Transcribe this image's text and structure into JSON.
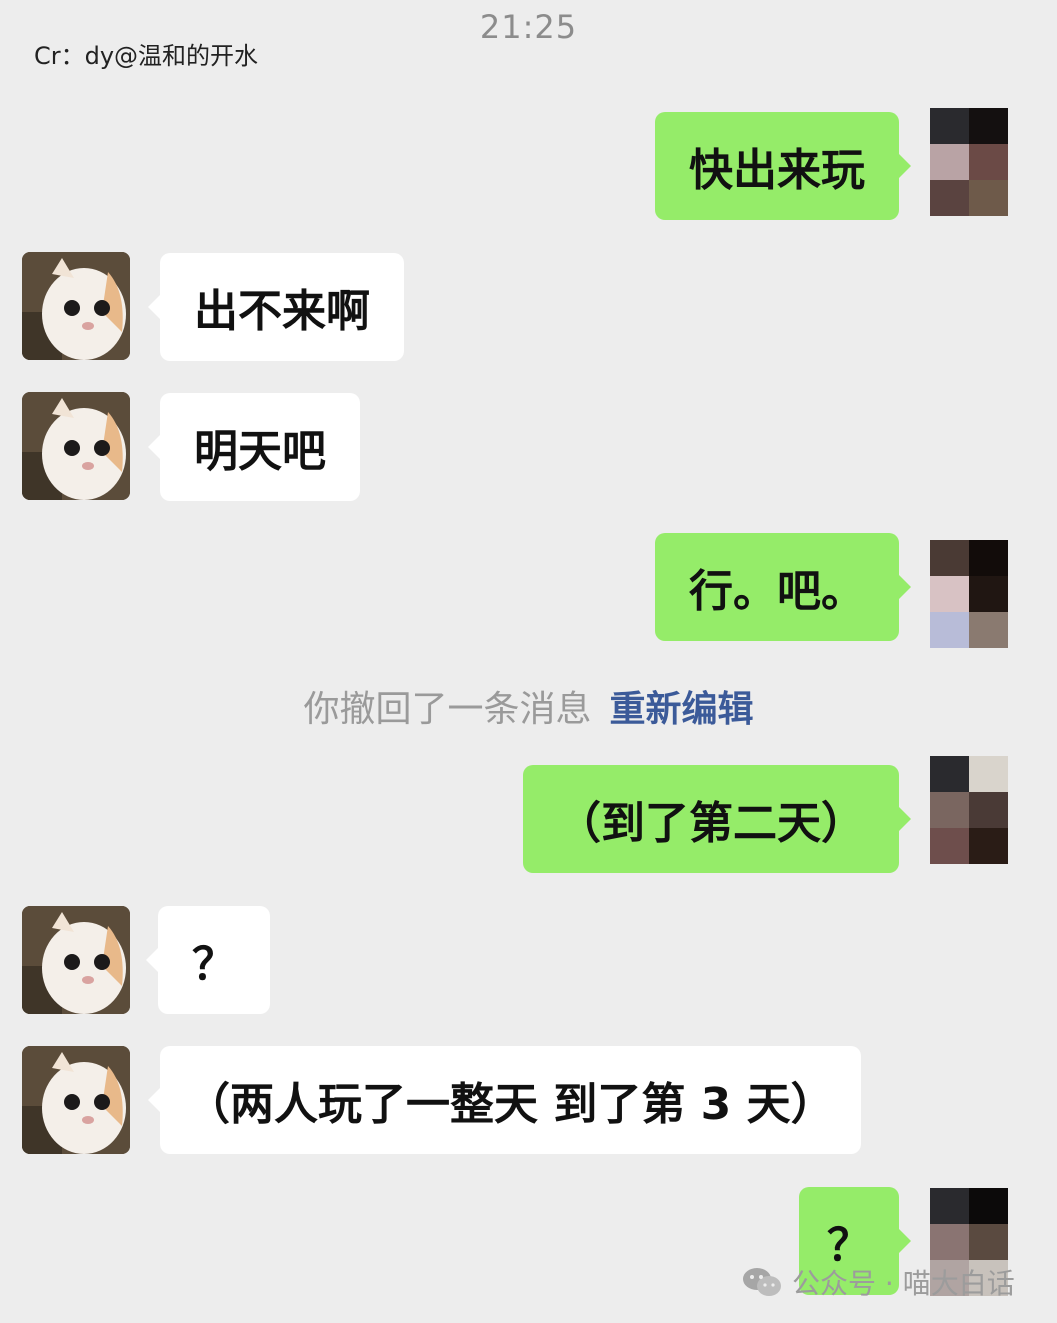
{
  "header": {
    "credit": "Cr：dy@温和的开水",
    "time": "21:25"
  },
  "messages": [
    {
      "side": "out",
      "text": "快出来玩"
    },
    {
      "side": "in",
      "text": "出不来啊"
    },
    {
      "side": "in",
      "text": "明天吧"
    },
    {
      "side": "out",
      "text": "行。吧。"
    },
    {
      "side": "out",
      "text": "（到了第二天）"
    },
    {
      "side": "in",
      "text": "？"
    },
    {
      "side": "in",
      "text": "（两人玩了一整天 到了第 3 天）"
    },
    {
      "side": "out",
      "text": "？"
    }
  ],
  "system_notice": {
    "text": "你撤回了一条消息",
    "action": "重新编辑"
  },
  "watermark": {
    "text": "公众号 · 喵大白话"
  },
  "colors": {
    "background": "#ededed",
    "outgoing_bubble": "#95ec69",
    "incoming_bubble": "#ffffff",
    "link": "#3b5a99"
  }
}
